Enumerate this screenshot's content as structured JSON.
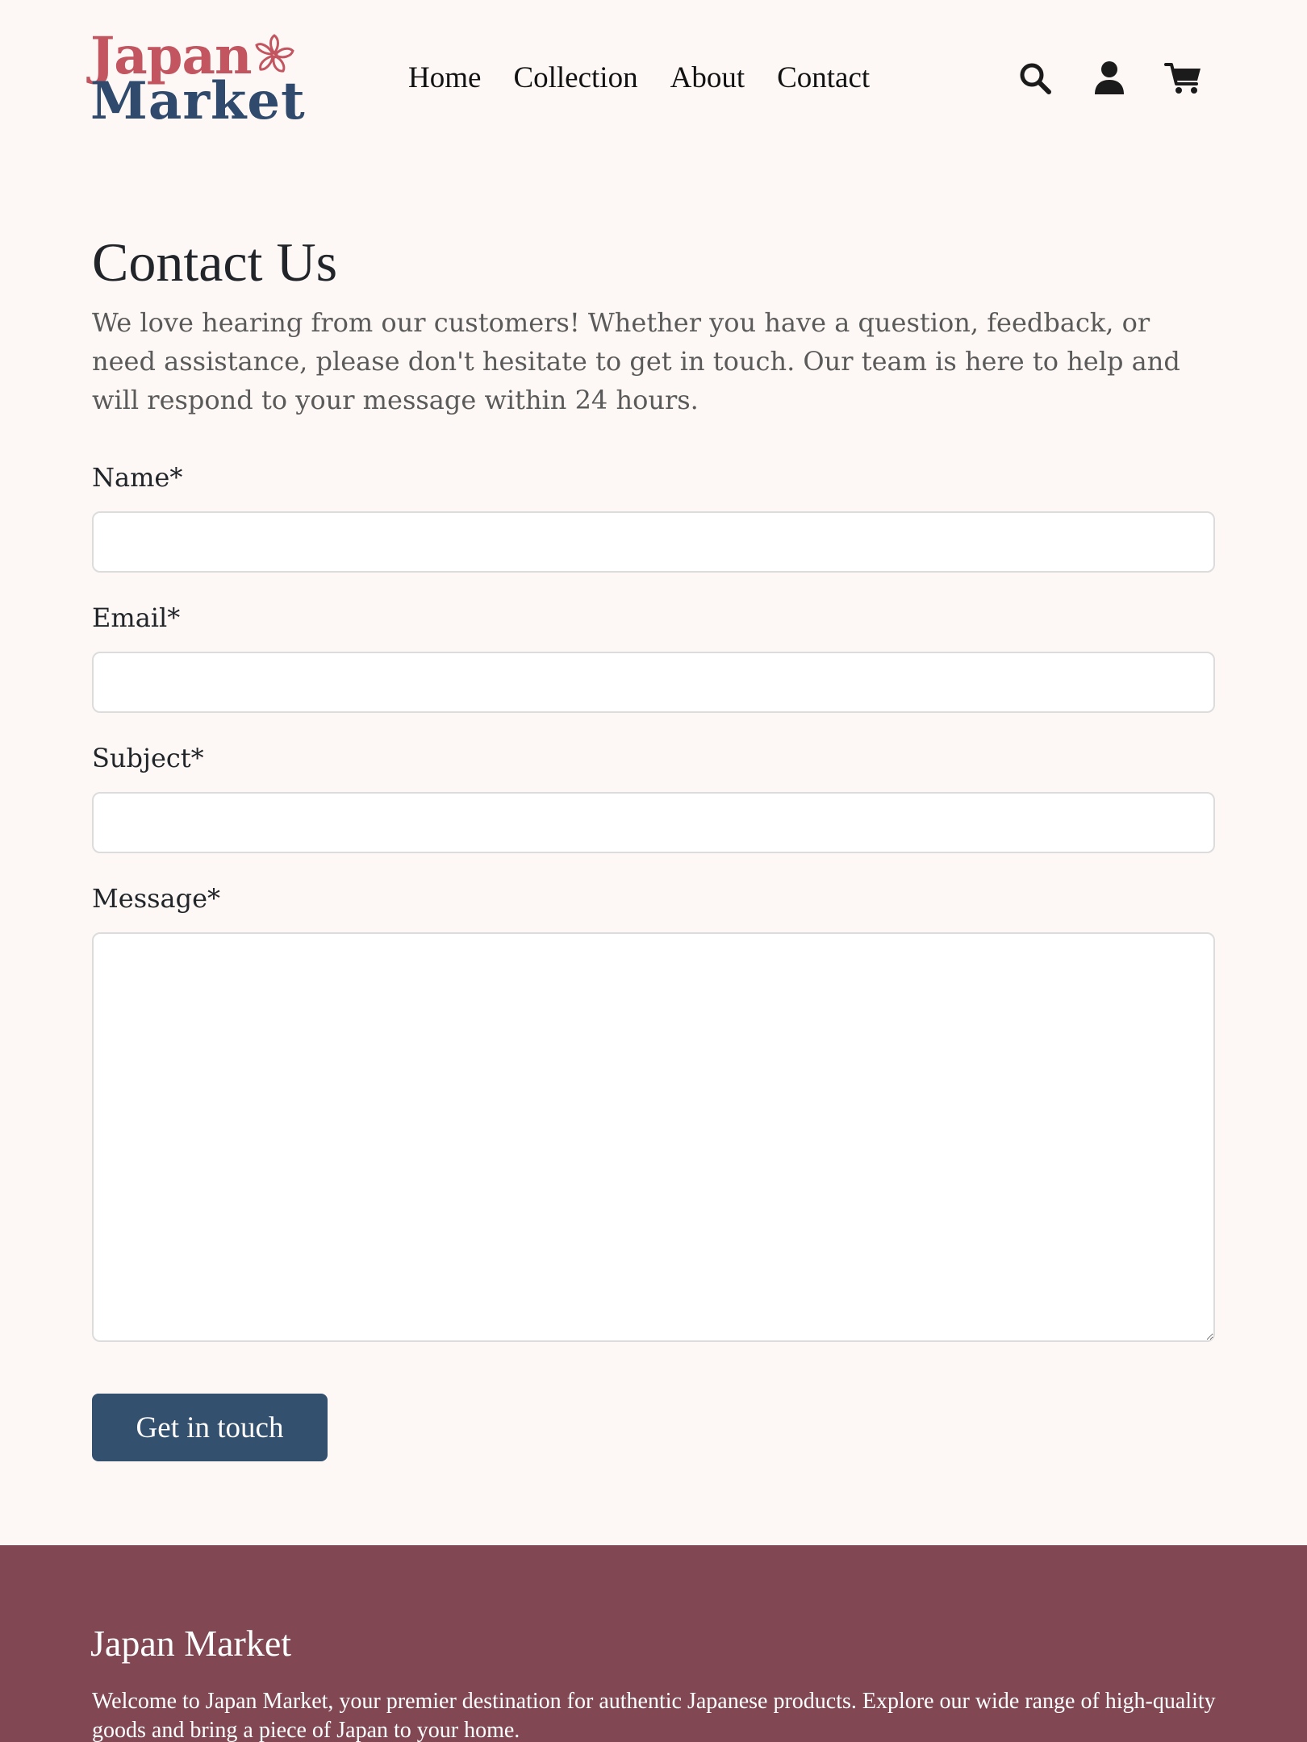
{
  "brand": {
    "logo_line1": "Japan",
    "logo_line2": "Market",
    "logo_icon": "sakura-flower-icon",
    "color_primary": "#c2555f",
    "color_secondary": "#2f4a6c"
  },
  "nav": {
    "items": [
      {
        "label": "Home"
      },
      {
        "label": "Collection"
      },
      {
        "label": "About"
      },
      {
        "label": "Contact"
      }
    ]
  },
  "header_icons": [
    "search-icon",
    "user-icon",
    "cart-icon"
  ],
  "page": {
    "title": "Contact Us",
    "intro": "We love hearing from our customers! Whether you have a question, feedback, or need assistance, please don't hesitate to get in touch. Our team is here to help and will respond to your message within 24 hours."
  },
  "form": {
    "name_label": "Name*",
    "name_value": "",
    "email_label": "Email*",
    "email_value": "",
    "subject_label": "Subject*",
    "subject_value": "",
    "message_label": "Message*",
    "message_value": "",
    "submit_label": "Get in touch",
    "submit_color": "#34506f"
  },
  "footer": {
    "title": "Japan Market",
    "text": "Welcome to Japan Market, your premier destination for authentic Japanese products. Explore our wide range of high-quality goods and bring a piece of Japan to your home.",
    "background": "#814854"
  }
}
